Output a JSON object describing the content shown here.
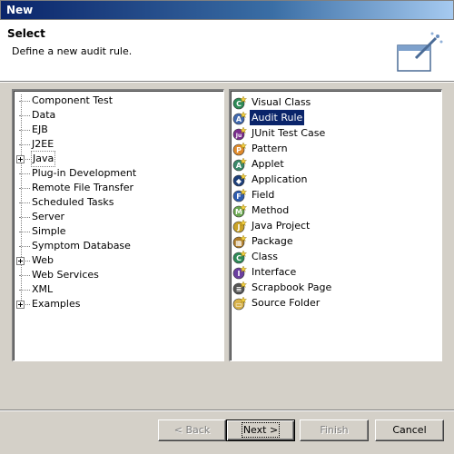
{
  "window": {
    "title": "New"
  },
  "banner": {
    "title": "Select",
    "message": "Define a new audit rule.",
    "icon": "new-wizard-icon"
  },
  "categories": [
    {
      "label": "Component Test",
      "expandable": false
    },
    {
      "label": "Data",
      "expandable": false
    },
    {
      "label": "EJB",
      "expandable": false
    },
    {
      "label": "J2EE",
      "expandable": false
    },
    {
      "label": "Java",
      "expandable": true,
      "selected": true
    },
    {
      "label": "Plug-in Development",
      "expandable": false
    },
    {
      "label": "Remote File Transfer",
      "expandable": false
    },
    {
      "label": "Scheduled Tasks",
      "expandable": false
    },
    {
      "label": "Server",
      "expandable": false
    },
    {
      "label": "Simple",
      "expandable": false
    },
    {
      "label": "Symptom Database",
      "expandable": false
    },
    {
      "label": "Web",
      "expandable": true
    },
    {
      "label": "Web Services",
      "expandable": false
    },
    {
      "label": "XML",
      "expandable": false
    },
    {
      "label": "Examples",
      "expandable": true
    }
  ],
  "wizards": [
    {
      "label": "Visual Class",
      "icon": "visual-class-icon",
      "color": "#2e8b57",
      "glyph": "C"
    },
    {
      "label": "Audit Rule",
      "icon": "audit-rule-icon",
      "color": "#4169b0",
      "glyph": "A",
      "selected": true
    },
    {
      "label": "JUnit Test Case",
      "icon": "junit-icon",
      "color": "#7b2d8e",
      "glyph": "Ju"
    },
    {
      "label": "Pattern",
      "icon": "pattern-icon",
      "color": "#e08a2b",
      "glyph": "P"
    },
    {
      "label": "Applet",
      "icon": "applet-icon",
      "color": "#3a8a6a",
      "glyph": "A"
    },
    {
      "label": "Application",
      "icon": "application-icon",
      "color": "#1d3f7a",
      "glyph": "◆"
    },
    {
      "label": "Field",
      "icon": "field-icon",
      "color": "#2f5db0",
      "glyph": "F"
    },
    {
      "label": "Method",
      "icon": "method-icon",
      "color": "#6aa84f",
      "glyph": "M"
    },
    {
      "label": "Java Project",
      "icon": "java-project-icon",
      "color": "#c9a227",
      "glyph": "J"
    },
    {
      "label": "Package",
      "icon": "package-icon",
      "color": "#b07d2a",
      "glyph": "▦"
    },
    {
      "label": "Class",
      "icon": "class-icon",
      "color": "#2e8b57",
      "glyph": "C"
    },
    {
      "label": "Interface",
      "icon": "interface-icon",
      "color": "#6b3fa0",
      "glyph": "I"
    },
    {
      "label": "Scrapbook Page",
      "icon": "scrapbook-icon",
      "color": "#555555",
      "glyph": "≡"
    },
    {
      "label": "Source Folder",
      "icon": "source-folder-icon",
      "color": "#d8b24a",
      "glyph": "▭"
    }
  ],
  "buttons": {
    "back": "< Back",
    "next": "Next >",
    "finish": "Finish",
    "cancel": "Cancel"
  }
}
